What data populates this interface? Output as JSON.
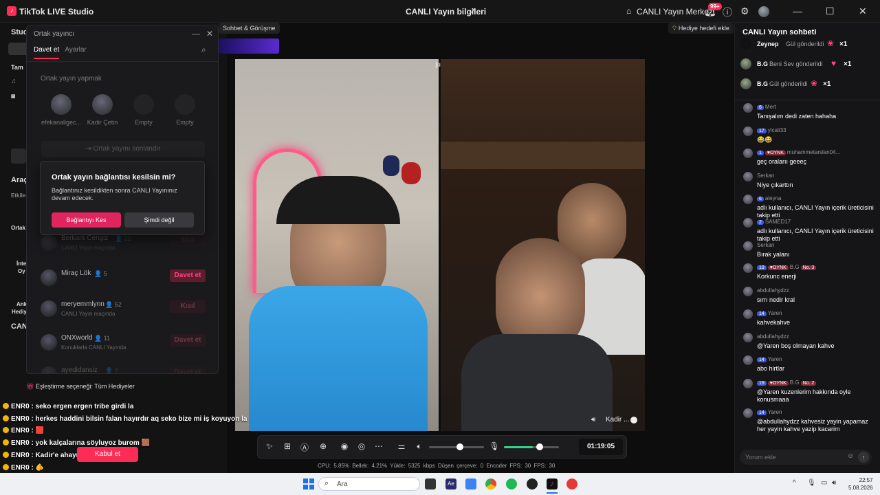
{
  "titlebar": {
    "app_title": "TikTok LIVE Studio",
    "center_title": "CANLI Yayın bilgileri",
    "home_label": "CANLI Yayın Merkezi",
    "notif_badge": "99+"
  },
  "studio_fragments": [
    "Stud",
    "Tam",
    "Araç",
    "Etkile",
    "Ortak",
    "İnte",
    "Oy",
    "Ank",
    "Hediy",
    "CAN"
  ],
  "cohost_panel": {
    "title": "Ortak yayıncı",
    "tabs": [
      "Davet et",
      "Ayarlar"
    ],
    "section_title": "Ortak yayın yapmak",
    "slots": [
      {
        "name": "efekanaligec...",
        "empty": false
      },
      {
        "name": "Kadir Çetin",
        "empty": false
      },
      {
        "name": "Empty",
        "empty": true
      },
      {
        "name": "Empty",
        "empty": true
      }
    ],
    "end_button": "Ortak yayını sonlandır",
    "list": [
      {
        "name": "Berkant Cengiz",
        "count": "22",
        "sub": "CANLI Yayın maçında",
        "button": "Skill",
        "dim": true
      },
      {
        "name": "Miraç Lök",
        "count": "5",
        "sub": "",
        "button": "Davet et",
        "dim": false
      },
      {
        "name": "meryemmlynn",
        "count": "52",
        "sub": "CANLI Yayın maçında",
        "button": "Kısıl",
        "dim": true
      },
      {
        "name": "ONXworld",
        "count": "11",
        "sub": "Konuklarla CANLI Yayında",
        "button": "Davet et",
        "dim": true
      },
      {
        "name": "ayedidansiz",
        "count": "7",
        "sub": "",
        "button": "Davet et",
        "dim": true
      }
    ]
  },
  "modal": {
    "title": "Ortak yayın bağlantısı kesilsin mi?",
    "description": "Bağlantınız kesildikten sonra CANLI Yayınınız devam edecek.",
    "confirm": "Bağlantıyı Kes",
    "cancel": "Şimdi değil"
  },
  "stage": {
    "pill_chat": "Sohbet & Görüşme",
    "gift_goal": "Hediye hedefi ekle",
    "cohost_name": "Kadir ...",
    "timer": "01:19:05",
    "stats": "CPU: 5.85%   Bellek: 4.21%   Yükle: 5325 kbps   Düşen çerçeve: 0   Encoder FPS: 30   FPS: 30"
  },
  "overlay": {
    "match_option": "Eşleştirme seçeneği: Tüm Hediyeler",
    "lines": [
      "ENR0 : seko ergen ergen tribe girdi la",
      "ENR0 : herkes haddini bilsin falan hayırdır aq seko bize mi iş koyuyon la",
      "ENR0 : 🟥",
      "ENR0 : yok kalçalarına söyluyoz burom 🟫",
      "ENR0 : Kadir'e ahayın",
      "ENR0 : 🫵"
    ],
    "accept_button": "Kabul et"
  },
  "chat": {
    "title": "CANLI Yayın sohbeti",
    "gifts": [
      {
        "user": "Zeynep",
        "text": "Gül gönderildi",
        "count": "×1"
      },
      {
        "user": "B.G",
        "text": "Beni Sev gönderildi",
        "count": "×1"
      },
      {
        "user": "B.G",
        "text": "Gül gönderildi",
        "count": "×1"
      }
    ],
    "messages": [
      {
        "level": "6",
        "oynk": false,
        "user": "Mert",
        "no": "",
        "text": "Tanışalım dedi zaten hahaha"
      },
      {
        "level": "17",
        "oynk": false,
        "user": "ylcali33",
        "no": "",
        "text": "😂😂"
      },
      {
        "level": "1",
        "oynk": true,
        "user": "muhammetarslan04...",
        "no": "",
        "text": "geç oralarıı geeeç"
      },
      {
        "level": "",
        "oynk": false,
        "user": "Serkan",
        "no": "",
        "text": "Niye çıkarttın"
      },
      {
        "level": "6",
        "oynk": false,
        "user": "aleyna",
        "no": "",
        "text": "adlı kullanıcı, CANLI Yayın içerik üreticisini takip etti"
      },
      {
        "level": "2",
        "oynk": false,
        "user": "SAMED17",
        "no": "",
        "text": "adlı kullanıcı, CANLI Yayın içerik üreticisini takip etti"
      },
      {
        "level": "",
        "oynk": false,
        "user": "Serkan",
        "no": "",
        "text": "Bırak yalanı"
      },
      {
        "level": "19",
        "oynk": true,
        "user": "B.G",
        "no": "No. 3",
        "text": "Korkunc enerji"
      },
      {
        "level": "",
        "oynk": false,
        "user": "abdullahydzz",
        "no": "",
        "text": "sırrı nedir kral"
      },
      {
        "level": "14",
        "oynk": false,
        "user": "Yaren",
        "no": "",
        "text": "kahvekahve"
      },
      {
        "level": "",
        "oynk": false,
        "user": "abdullahydzz",
        "no": "",
        "text": "@Yaren boş olmayan kahve"
      },
      {
        "level": "14",
        "oynk": false,
        "user": "Yaren",
        "no": "",
        "text": "abo hirtlar"
      },
      {
        "level": "19",
        "oynk": true,
        "user": "B.G",
        "no": "No. 2",
        "text": "@Yaren kuzenlerim hakkında oyle konusmaaa"
      },
      {
        "level": "14",
        "oynk": false,
        "user": "Yaren",
        "no": "",
        "text": "@abdullahydzz kahvesiz yayin yapamaz her yayin kahve yazip kacarim"
      }
    ],
    "input_placeholder": "Yorum ekle"
  },
  "taskbar": {
    "search_placeholder": "Ara",
    "time": "22:57",
    "date": "5.08.2026"
  },
  "colors": {
    "accent": "#fe2c55",
    "chat_level": "#3b5bdb"
  }
}
